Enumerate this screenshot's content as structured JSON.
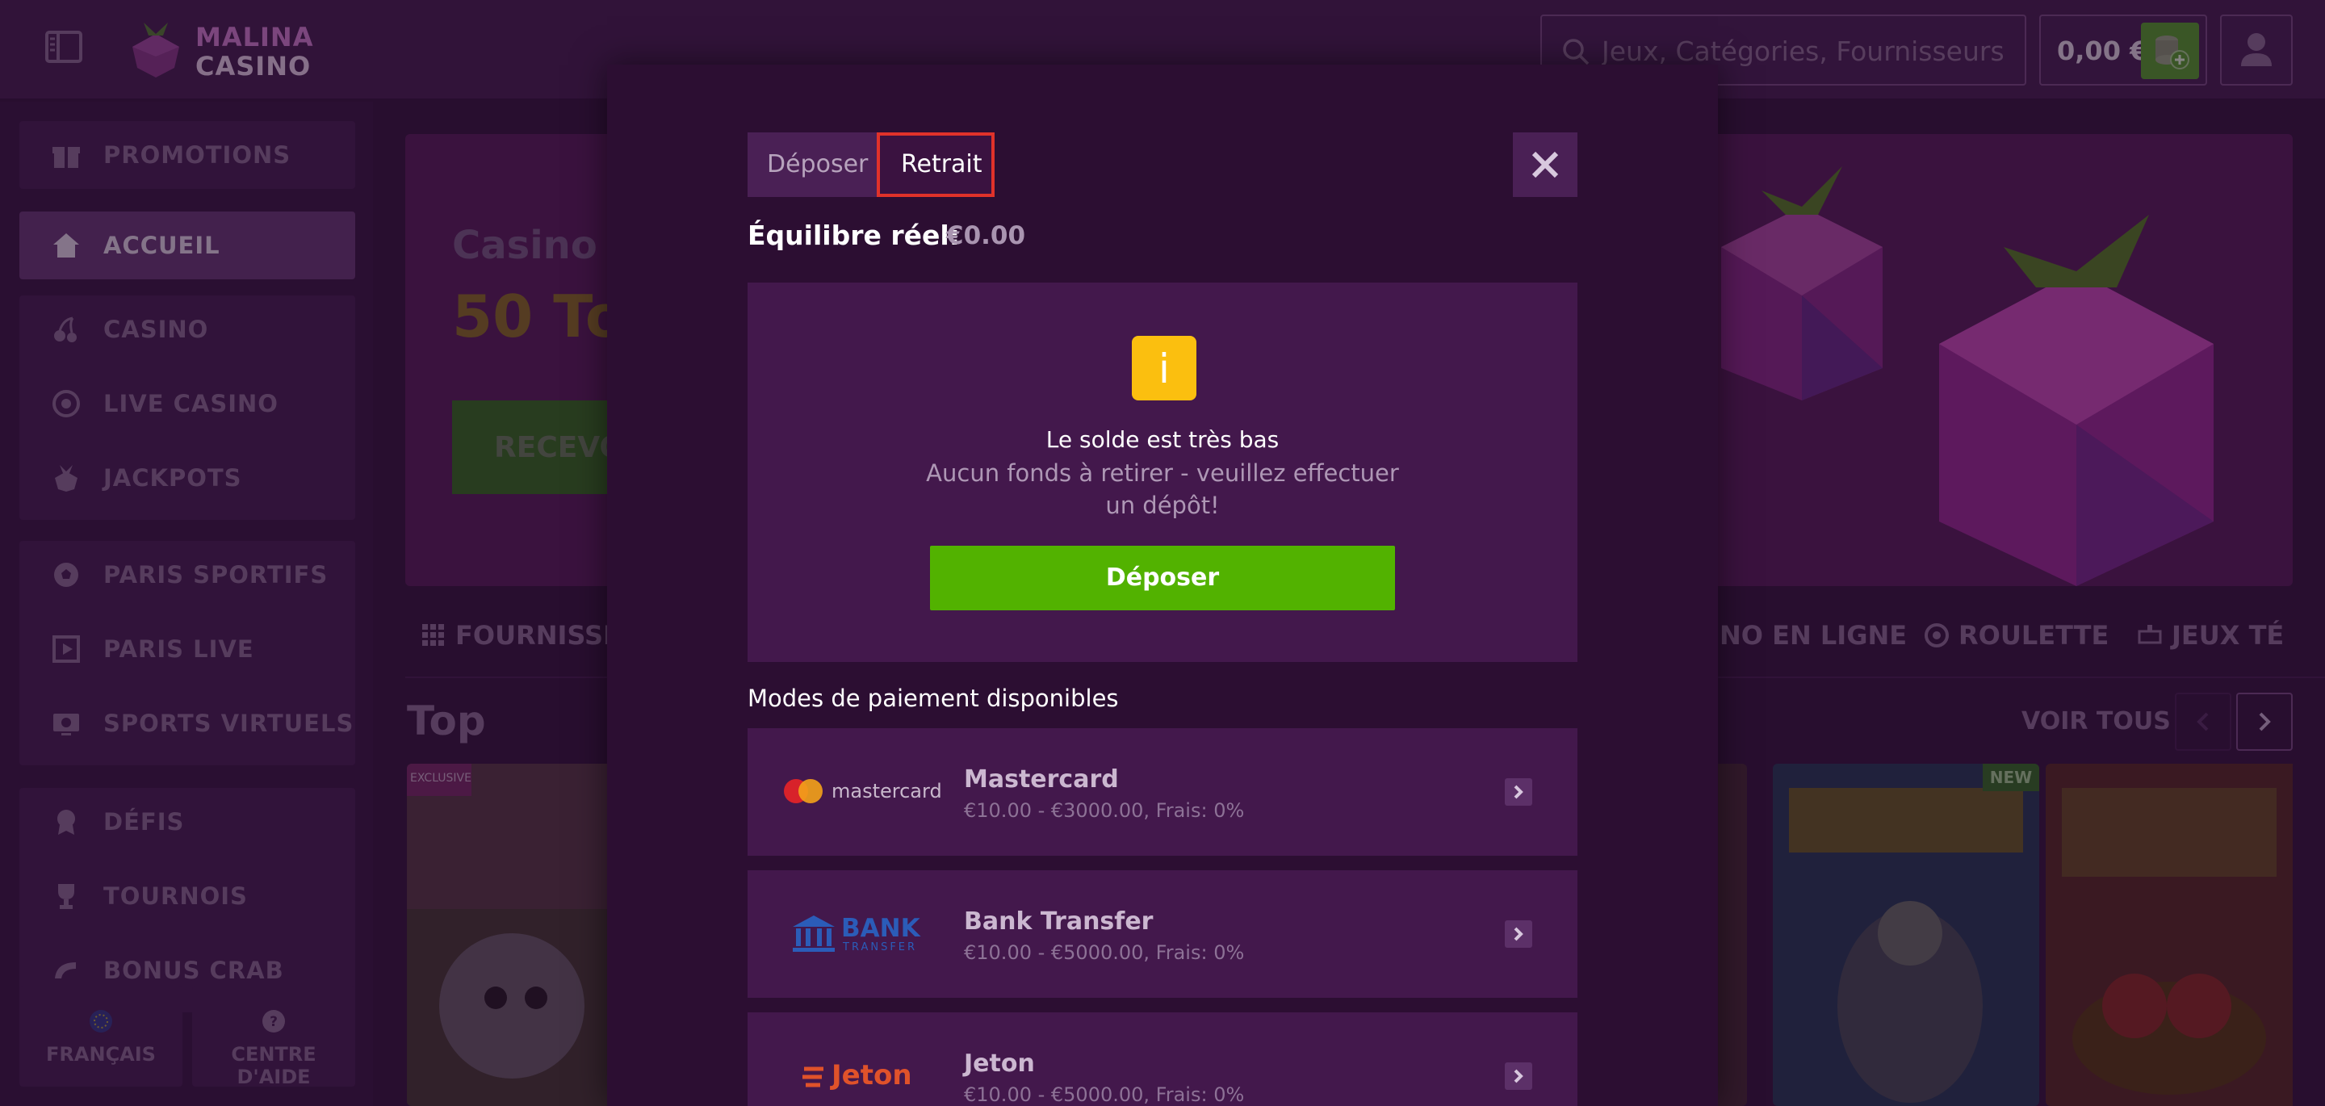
{
  "header": {
    "logo_line1": "MALINA",
    "logo_line2": "CASINO",
    "search_placeholder": "Jeux, Catégories, Fournisseurs",
    "balance": "0,00 €"
  },
  "sidebar": {
    "items": [
      {
        "label": "PROMOTIONS",
        "icon": "gift-icon"
      },
      {
        "label": "ACCUEIL",
        "icon": "home-icon"
      },
      {
        "label": "CASINO",
        "icon": "cherry-icon"
      },
      {
        "label": "LIVE CASINO",
        "icon": "roulette-icon"
      },
      {
        "label": "JACKPOTS",
        "icon": "raspberry-icon"
      },
      {
        "label": "PARIS SPORTIFS",
        "icon": "soccer-ball-icon"
      },
      {
        "label": "PARIS LIVE",
        "icon": "live-screen-icon"
      },
      {
        "label": "SPORTS VIRTUELS",
        "icon": "virtual-sports-icon"
      },
      {
        "label": "DÉFIS",
        "icon": "badge-icon"
      },
      {
        "label": "TOURNOIS",
        "icon": "trophy-icon"
      },
      {
        "label": "BONUS CRAB",
        "icon": "claw-icon"
      }
    ],
    "language": "FRANÇAIS",
    "help": "CENTRE D'AIDE"
  },
  "banner": {
    "line1": "Casino E",
    "line2": "50 To",
    "cta": "RECEVO"
  },
  "categories": {
    "providers": "FOURNISSEU",
    "online": "NO EN LIGNE",
    "roulette": "ROULETTE",
    "games": "JEUX TÉ"
  },
  "games_section": {
    "title": "Top",
    "see_all": "VOIR TOUS",
    "badge_exclusive": "EXCLUSIVE",
    "badge_new": "NEW"
  },
  "modal": {
    "tab_deposit": "Déposer",
    "tab_withdraw": "Retrait",
    "balance_label": "Équilibre réel:",
    "balance_value": "€0.00",
    "info_icon_glyph": "i",
    "info_title": "Le solde est très bas",
    "info_subtitle": "Aucun fonds à retirer - veuillez effectuer un dépôt!",
    "deposit_button": "Déposer",
    "methods_title": "Modes de paiement disponibles",
    "methods": [
      {
        "name": "Mastercard",
        "details": "€10.00 - €3000.00, Frais: 0%",
        "logo_text": "mastercard"
      },
      {
        "name": "Bank Transfer",
        "details": "€10.00 - €5000.00, Frais: 0%",
        "logo_text": "BANK",
        "logo_sub": "TRANSFER"
      },
      {
        "name": "Jeton",
        "details": "€10.00 - €5000.00, Frais: 0%",
        "logo_text": "Jeton"
      }
    ]
  },
  "colors": {
    "page_bg": "#3a1743",
    "modal_bg": "#2c0e32",
    "card_bg": "#43184c",
    "accent_green": "#52b200",
    "warning_yellow": "#fbbf0f",
    "highlight_red": "#e0322a"
  }
}
